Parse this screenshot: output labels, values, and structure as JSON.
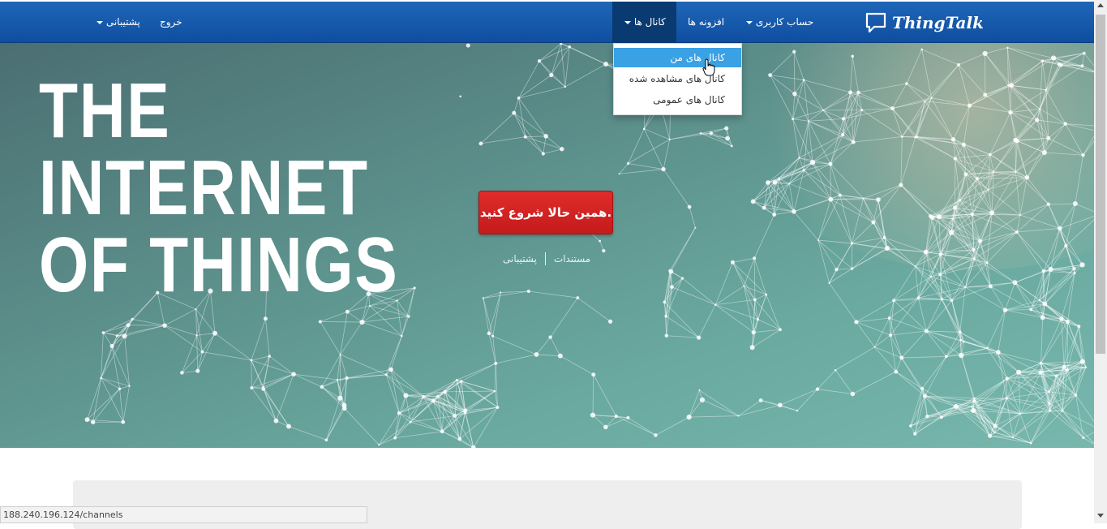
{
  "navbar": {
    "brand": "ThingTalk",
    "account_label": "حساب کاربری",
    "plugins_label": "افزونه ها",
    "channels_label": "کانال ها",
    "logout_label": "خروج",
    "support_label": "پشتیبانی"
  },
  "channels_menu": {
    "items": [
      "کانال های من",
      "کانال های مشاهده شده",
      "کانال های عمومی"
    ]
  },
  "hero": {
    "title_lines": [
      "THE",
      "INTERNET",
      "OF THINGS"
    ],
    "cta_label": "همین حالا شروع کنید.",
    "docs_label": "مستندات",
    "support_label": "پشتیبانی"
  },
  "status_bar": {
    "url": "188.240.196.124/channels"
  },
  "colors": {
    "navbar": "#1259ab",
    "cta": "#d42222",
    "menu_hover": "#3aa1e4"
  }
}
